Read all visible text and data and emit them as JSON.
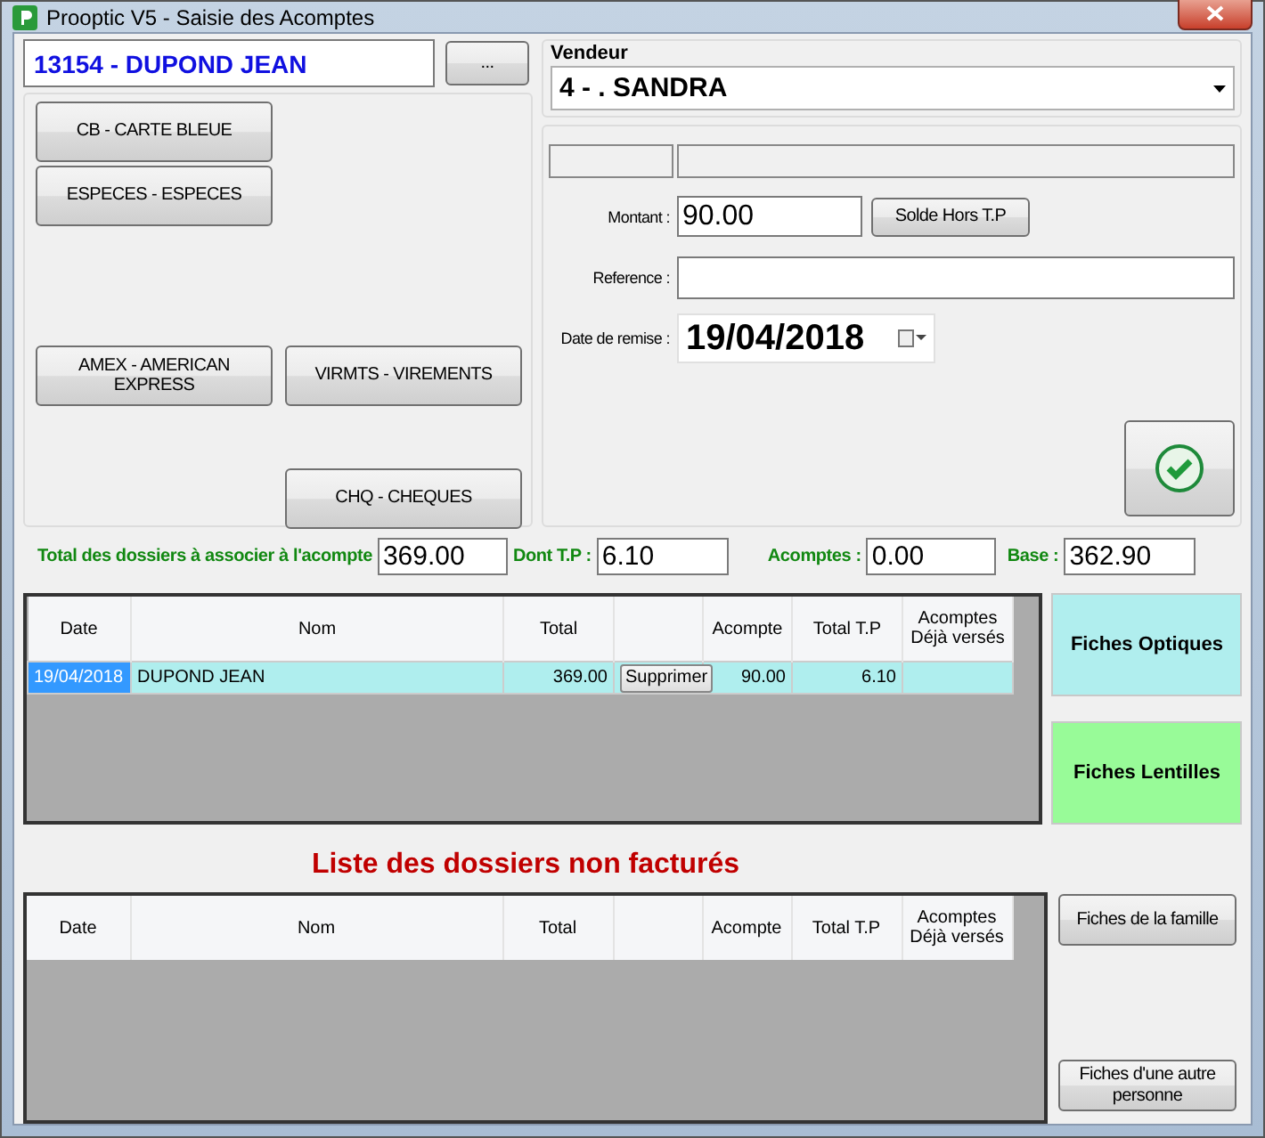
{
  "window": {
    "title": "Prooptic V5 - Saisie des Acomptes"
  },
  "client": {
    "value": "13154 - DUPOND JEAN"
  },
  "browse_button": "...",
  "vendeur": {
    "label": "Vendeur",
    "value": "4 - . SANDRA"
  },
  "payment_modes": [
    "CB - CARTE BLEUE",
    "ESPECES - ESPECES",
    "AMEX - AMERICAN EXPRESS",
    "VIRMTS - VIREMENTS",
    "CHQ - CHEQUES"
  ],
  "form": {
    "montant": {
      "label": "Montant :",
      "value": "90.00"
    },
    "solde_button": "Solde Hors T.P",
    "reference": {
      "label": "Reference :"
    },
    "date": {
      "label": "Date de remise :",
      "value": "19/04/2018"
    }
  },
  "totals": [
    {
      "label": "Total des  dossiers à associer à l'acompte",
      "value": "369.00"
    },
    {
      "label": "Dont T.P :",
      "value": "6.10"
    },
    {
      "label": "Acomptes :",
      "value": "0.00"
    },
    {
      "label": "Base :",
      "value": "362.90"
    }
  ],
  "table1": {
    "columns": [
      "Date",
      "Nom",
      "Total",
      "Acompte",
      "Total T.P",
      "Acomptes Déjà versés"
    ],
    "rows": [
      {
        "date": "19/04/2018",
        "nom": "DUPOND JEAN",
        "total": "369.00",
        "action": "Supprimer",
        "acompte": "90.00",
        "total_tp": "6.10",
        "selected": true
      }
    ]
  },
  "side_buttons": [
    {
      "label": "Fiches Optiques",
      "color": "#b0eeee"
    },
    {
      "label": "Fiches Lentilles",
      "color": "#98fb98"
    }
  ],
  "section_title": "Liste des dossiers non facturés",
  "table2": {
    "columns": [
      "Date",
      "Nom",
      "Total",
      "Acompte",
      "Total T.P",
      "Acomptes Déjà versés"
    ]
  },
  "bottom_buttons": [
    "Fiches de la famille",
    "Fiches d'une autre personne"
  ]
}
